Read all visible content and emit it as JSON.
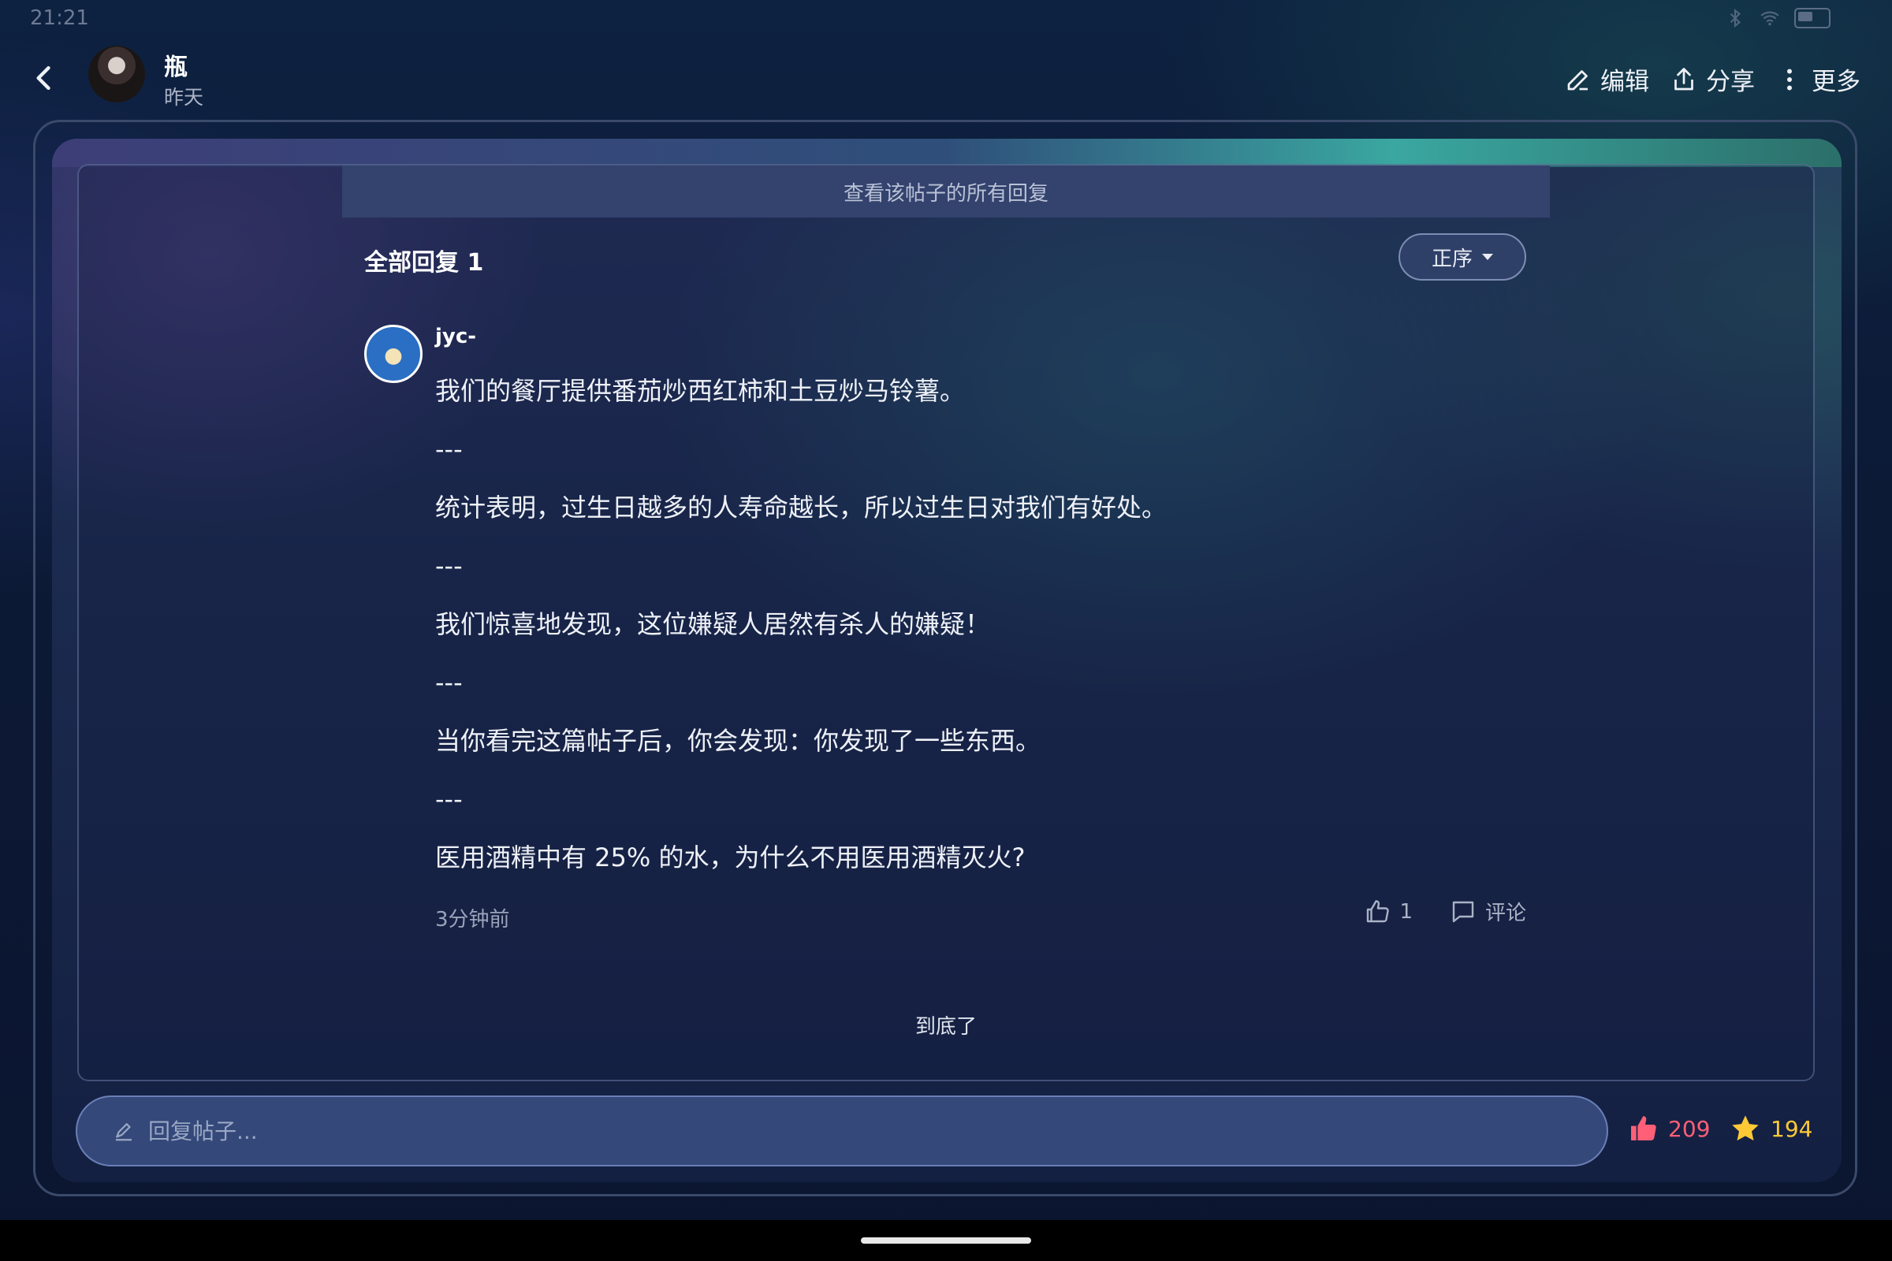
{
  "status_bar": {
    "time": "21:21",
    "battery": ""
  },
  "header": {
    "user_name": "瓶",
    "post_time": "昨天",
    "edit_label": "编辑",
    "share_label": "分享",
    "more_label": "更多"
  },
  "view_all_banner": "查看该帖子的所有回复",
  "replies": {
    "heading": "全部回复 1",
    "sort_label": "正序",
    "items": [
      {
        "author": "jyc-",
        "lines": [
          "我们的餐厅提供番茄炒西红柿和土豆炒马铃薯。",
          "---",
          "统计表明，过生日越多的人寿命越长，所以过生日对我们有好处。",
          "---",
          "我们惊喜地发现，这位嫌疑人居然有杀人的嫌疑！",
          "---",
          "当你看完这篇帖子后，你会发现：你发现了一些东西。",
          "---",
          "医用酒精中有 25% 的水，为什么不用医用酒精灭火?"
        ],
        "time": "3分钟前",
        "like_count": "1",
        "comment_label": "评论"
      }
    ],
    "end_text": "到底了"
  },
  "footer": {
    "reply_placeholder": "回复帖子...",
    "like_count": "209",
    "favorite_count": "194"
  },
  "colors": {
    "like": "#ff5f77",
    "favorite": "#ffc935",
    "accent_teal": "#3aa7a0"
  }
}
